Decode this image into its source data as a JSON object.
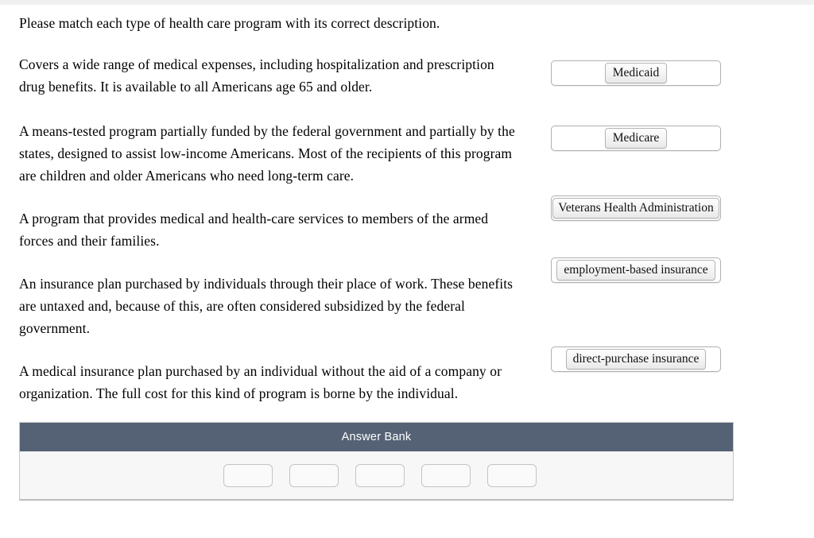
{
  "colors": {
    "bank_header_bg": "#556275",
    "bank_header_text": "#ffffff",
    "bank_body_bg": "#f7f7f7",
    "panel_border": "#c8c8c8",
    "token_border": "#b5b5b5",
    "dropzone_border": "#b0b0b0",
    "page_bg": "#ffffff",
    "text": "#000000"
  },
  "prompt": {
    "text": "Please match each type of health care program with its correct description."
  },
  "descriptions": [
    {
      "id": "desc-1",
      "text": "Covers a wide range of medical expenses, including hospitalization and prescription drug benefits. It is available to all Americans age 65 and older."
    },
    {
      "id": "desc-2",
      "text": "A means-tested program partially funded by the federal government and partially by the states, designed to assist low-income Americans. Most of the recipients of this program are children and older Americans who need long-term care."
    },
    {
      "id": "desc-3",
      "text": "A program that provides medical and health-care services to members of the armed forces and their families."
    },
    {
      "id": "desc-4",
      "text": "An insurance plan purchased by individuals through their place of work. These benefits are untaxed and, because of this, are often considered subsidized by the federal government."
    },
    {
      "id": "desc-5",
      "text": "A medical insurance plan purchased by an individual without the aid of a company or organization. The full cost for this kind of program is borne by the individual."
    }
  ],
  "drop_zones": [
    {
      "id": "dz-1",
      "token_label": "Medicaid"
    },
    {
      "id": "dz-2",
      "token_label": "Medicare"
    },
    {
      "id": "dz-3",
      "token_label": "Veterans Health Administration"
    },
    {
      "id": "dz-4",
      "token_label": "employment-based insurance"
    },
    {
      "id": "dz-5",
      "token_label": "direct-purchase insurance"
    }
  ],
  "answer_bank": {
    "title": "Answer Bank",
    "empty_slot_count": 5,
    "slots": [
      "",
      "",
      "",
      "",
      ""
    ]
  }
}
